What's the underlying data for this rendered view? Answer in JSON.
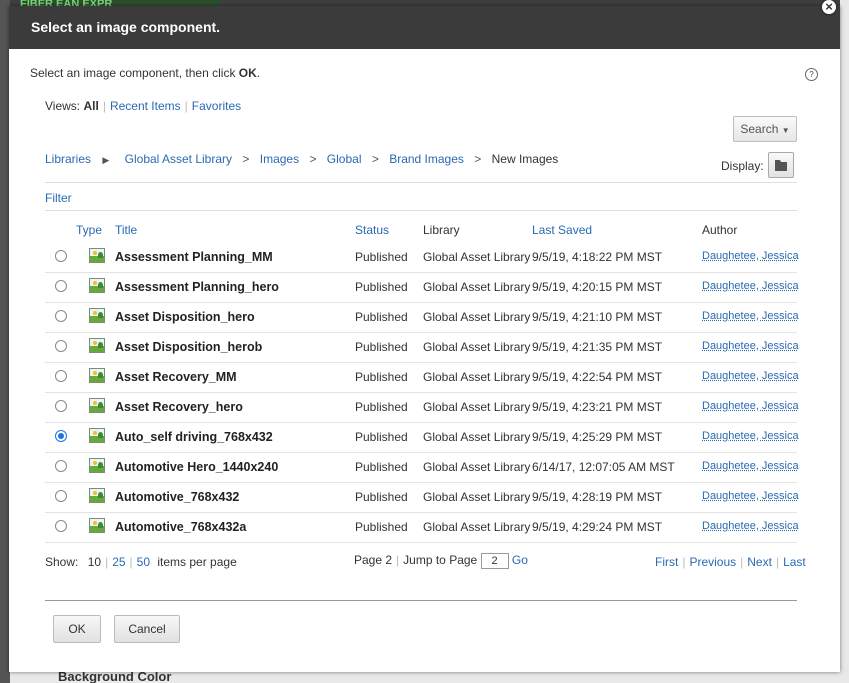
{
  "background": {
    "top_text": "FIBER EAN EXPR",
    "bottom_text": "Background Color"
  },
  "dialog": {
    "title": "Select an image component.",
    "close_symbol": "×",
    "instruction_prefix": "Select an image component, then click ",
    "instruction_bold": "OK",
    "instruction_suffix": ".",
    "help_symbol": "?"
  },
  "views": {
    "label": "Views:",
    "all": "All",
    "recent": "Recent Items",
    "favorites": "Favorites"
  },
  "search": {
    "label": "Search"
  },
  "breadcrumb": {
    "libraries": "Libraries",
    "items": [
      "Global Asset Library",
      "Images",
      "Global",
      "Brand Images"
    ],
    "current": "New Images",
    "separator": ">"
  },
  "display": {
    "label": "Display:",
    "icon": "folder-icon"
  },
  "filter": {
    "label": "Filter"
  },
  "table": {
    "headers": {
      "type": "Type",
      "title": "Title",
      "status": "Status",
      "library": "Library",
      "last_saved": "Last Saved",
      "author": "Author"
    },
    "rows": [
      {
        "title": "Assessment Planning_MM",
        "status": "Published",
        "library": "Global Asset Library",
        "saved": "9/5/19, 4:18:22 PM MST",
        "author": "Daughetee, Jessica",
        "selected": false
      },
      {
        "title": "Assessment Planning_hero",
        "status": "Published",
        "library": "Global Asset Library",
        "saved": "9/5/19, 4:20:15 PM MST",
        "author": "Daughetee, Jessica",
        "selected": false
      },
      {
        "title": "Asset Disposition_hero",
        "status": "Published",
        "library": "Global Asset Library",
        "saved": "9/5/19, 4:21:10 PM MST",
        "author": "Daughetee, Jessica",
        "selected": false
      },
      {
        "title": "Asset Disposition_herob",
        "status": "Published",
        "library": "Global Asset Library",
        "saved": "9/5/19, 4:21:35 PM MST",
        "author": "Daughetee, Jessica",
        "selected": false
      },
      {
        "title": "Asset Recovery_MM",
        "status": "Published",
        "library": "Global Asset Library",
        "saved": "9/5/19, 4:22:54 PM MST",
        "author": "Daughetee, Jessica",
        "selected": false
      },
      {
        "title": "Asset Recovery_hero",
        "status": "Published",
        "library": "Global Asset Library",
        "saved": "9/5/19, 4:23:21 PM MST",
        "author": "Daughetee, Jessica",
        "selected": false
      },
      {
        "title": "Auto_self driving_768x432",
        "status": "Published",
        "library": "Global Asset Library",
        "saved": "9/5/19, 4:25:29 PM MST",
        "author": "Daughetee, Jessica",
        "selected": true
      },
      {
        "title": "Automotive Hero_1440x240",
        "status": "Published",
        "library": "Global Asset Library",
        "saved": "6/14/17, 12:07:05 AM MST",
        "author": "Daughetee, Jessica",
        "selected": false
      },
      {
        "title": "Automotive_768x432",
        "status": "Published",
        "library": "Global Asset Library",
        "saved": "9/5/19, 4:28:19 PM MST",
        "author": "Daughetee, Jessica",
        "selected": false
      },
      {
        "title": "Automotive_768x432a",
        "status": "Published",
        "library": "Global Asset Library",
        "saved": "9/5/19, 4:29:24 PM MST",
        "author": "Daughetee, Jessica",
        "selected": false
      }
    ]
  },
  "pagination": {
    "show_label": "Show:",
    "sizes": [
      "10",
      "25",
      "50"
    ],
    "per_page_label": "items per page",
    "page_label": "Page 2",
    "jump_label": "Jump to Page",
    "jump_value": "2",
    "go": "Go",
    "first": "First",
    "previous": "Previous",
    "next": "Next",
    "last": "Last"
  },
  "buttons": {
    "ok": "OK",
    "cancel": "Cancel"
  }
}
